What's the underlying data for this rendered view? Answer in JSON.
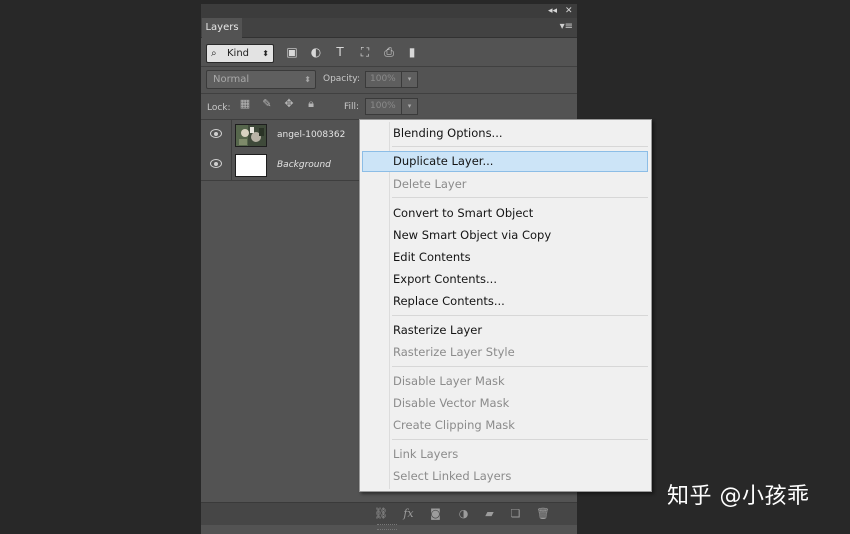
{
  "window": {
    "collapse_glyph": "◂◂",
    "close_glyph": "✕",
    "panel_menu_glyph": "▾≡"
  },
  "panel": {
    "tab_label": "Layers"
  },
  "filter": {
    "kind_label": "Kind",
    "kind_arrow": "⬍",
    "search_glyph": "⌕",
    "icons": [
      {
        "name": "pixel-filter-icon",
        "glyph": "▣"
      },
      {
        "name": "adjustment-filter-icon",
        "glyph": "◐"
      },
      {
        "name": "type-filter-icon",
        "glyph": "T"
      },
      {
        "name": "shape-filter-icon",
        "glyph": "⛶"
      },
      {
        "name": "smart-object-filter-icon",
        "glyph": "⎙"
      },
      {
        "name": "filter-toggle-icon",
        "glyph": "▮"
      }
    ]
  },
  "blend": {
    "mode_value": "Normal",
    "mode_arrow": "⬍",
    "opacity_label": "Opacity:",
    "opacity_value": "100%",
    "dropdown_arrow": "▾"
  },
  "lock": {
    "label": "Lock:",
    "icons": [
      {
        "name": "lock-transparent-pixels-icon",
        "glyph": "▦"
      },
      {
        "name": "lock-image-pixels-icon",
        "glyph": "✎"
      },
      {
        "name": "lock-position-icon",
        "glyph": "✥"
      },
      {
        "name": "lock-all-icon",
        "glyph": "🔒︎"
      }
    ],
    "fill_label": "Fill:",
    "fill_value": "100%",
    "dropdown_arrow": "▾"
  },
  "layers": [
    {
      "name": "angel-1008362",
      "italic": false,
      "visible": true
    },
    {
      "name": "Background",
      "italic": true,
      "visible": true
    }
  ],
  "bottom_bar": {
    "icons": [
      {
        "name": "link-layers-icon",
        "glyph": "⛓"
      },
      {
        "name": "layer-style-fx-icon",
        "glyph": "fx"
      },
      {
        "name": "add-mask-icon",
        "glyph": "◙"
      },
      {
        "name": "new-adjustment-layer-icon",
        "glyph": "◑"
      },
      {
        "name": "new-group-folder-icon",
        "glyph": "▰"
      },
      {
        "name": "new-layer-icon",
        "glyph": "❏"
      },
      {
        "name": "delete-layer-icon",
        "glyph": "🗑︎"
      }
    ]
  },
  "context_menu": {
    "items": [
      {
        "label": "Blending Options...",
        "enabled": true,
        "highlighted": false
      },
      {
        "separator": true
      },
      {
        "label": "Duplicate Layer...",
        "enabled": true,
        "highlighted": true
      },
      {
        "label": "Delete Layer",
        "enabled": false,
        "highlighted": false
      },
      {
        "separator": true
      },
      {
        "label": "Convert to Smart Object",
        "enabled": true,
        "highlighted": false
      },
      {
        "label": "New Smart Object via Copy",
        "enabled": true,
        "highlighted": false
      },
      {
        "label": "Edit Contents",
        "enabled": true,
        "highlighted": false
      },
      {
        "label": "Export Contents...",
        "enabled": true,
        "highlighted": false
      },
      {
        "label": "Replace Contents...",
        "enabled": true,
        "highlighted": false
      },
      {
        "separator": true
      },
      {
        "label": "Rasterize Layer",
        "enabled": true,
        "highlighted": false
      },
      {
        "label": "Rasterize Layer Style",
        "enabled": false,
        "highlighted": false
      },
      {
        "separator": true
      },
      {
        "label": "Disable Layer Mask",
        "enabled": false,
        "highlighted": false
      },
      {
        "label": "Disable Vector Mask",
        "enabled": false,
        "highlighted": false
      },
      {
        "label": "Create Clipping Mask",
        "enabled": false,
        "highlighted": false
      },
      {
        "separator": true
      },
      {
        "label": "Link Layers",
        "enabled": false,
        "highlighted": false
      },
      {
        "label": "Select Linked Layers",
        "enabled": false,
        "highlighted": false
      }
    ]
  },
  "watermark": {
    "text": "知乎 @小孩乖"
  }
}
